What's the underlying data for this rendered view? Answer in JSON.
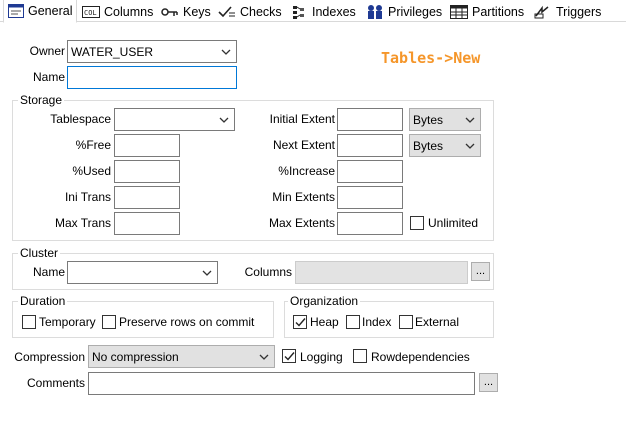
{
  "tabs": [
    {
      "label": "General",
      "icon": "general-tab-icon",
      "active": true
    },
    {
      "label": "Columns",
      "icon": "columns-tab-icon"
    },
    {
      "label": "Keys",
      "icon": "keys-tab-icon"
    },
    {
      "label": "Checks",
      "icon": "checks-tab-icon"
    },
    {
      "label": "Indexes",
      "icon": "indexes-tab-icon"
    },
    {
      "label": "Privileges",
      "icon": "privileges-tab-icon"
    },
    {
      "label": "Partitions",
      "icon": "partitions-tab-icon"
    },
    {
      "label": "Triggers",
      "icon": "triggers-tab-icon"
    }
  ],
  "overlay_title": "Tables->New",
  "owner": {
    "label": "Owner",
    "value": "WATER_USER"
  },
  "name": {
    "label": "Name",
    "value": ""
  },
  "storage": {
    "title": "Storage",
    "tablespace": {
      "label": "Tablespace",
      "value": ""
    },
    "pct_free": {
      "label": "%Free",
      "value": ""
    },
    "pct_used": {
      "label": "%Used",
      "value": ""
    },
    "ini_trans": {
      "label": "Ini Trans",
      "value": ""
    },
    "max_trans": {
      "label": "Max Trans",
      "value": ""
    },
    "initial_extent": {
      "label": "Initial Extent",
      "value": "",
      "unit": "Bytes"
    },
    "next_extent": {
      "label": "Next Extent",
      "value": "",
      "unit": "Bytes"
    },
    "pct_increase": {
      "label": "%Increase",
      "value": ""
    },
    "min_extents": {
      "label": "Min Extents",
      "value": ""
    },
    "max_extents": {
      "label": "Max Extents",
      "value": ""
    },
    "unlimited": {
      "label": "Unlimited",
      "checked": false
    }
  },
  "cluster": {
    "title": "Cluster",
    "name": {
      "label": "Name",
      "value": ""
    },
    "columns": {
      "label": "Columns",
      "value": ""
    },
    "browse_label": "..."
  },
  "duration": {
    "title": "Duration",
    "temporary": {
      "label": "Temporary",
      "checked": false
    },
    "preserve_rows": {
      "label": "Preserve rows on commit",
      "checked": false
    }
  },
  "organization": {
    "title": "Organization",
    "heap": {
      "label": "Heap",
      "checked": true
    },
    "index": {
      "label": "Index",
      "checked": false
    },
    "external": {
      "label": "External",
      "checked": false
    }
  },
  "compression": {
    "label": "Compression",
    "value": "No compression"
  },
  "logging": {
    "label": "Logging",
    "checked": true
  },
  "rowdependencies": {
    "label": "Rowdependencies",
    "checked": false
  },
  "comments": {
    "label": "Comments",
    "value": "",
    "browse_label": "..."
  }
}
